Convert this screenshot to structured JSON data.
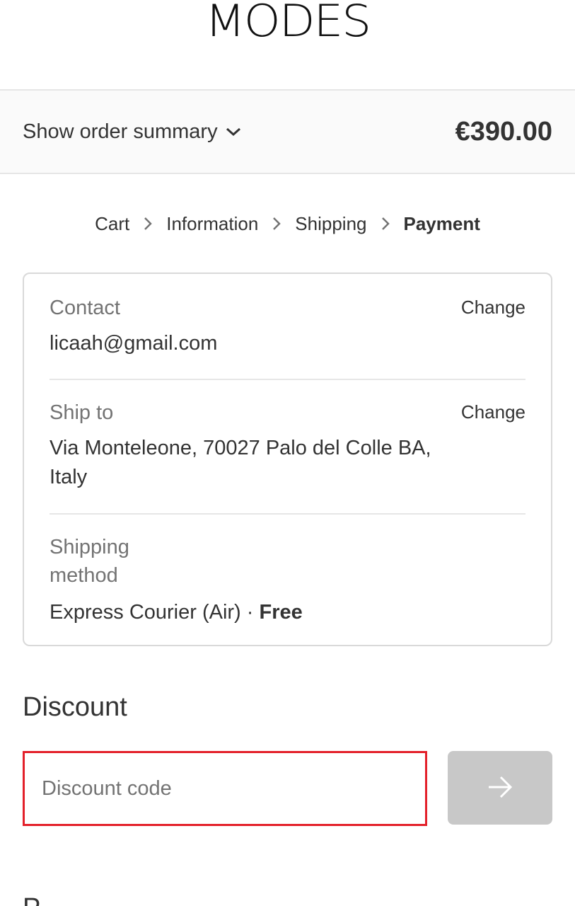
{
  "brand": {
    "logo_text": "MODES"
  },
  "summary": {
    "toggle_label": "Show order summary",
    "total": "€390.00"
  },
  "breadcrumb": {
    "items": [
      "Cart",
      "Information",
      "Shipping",
      "Payment"
    ]
  },
  "review": {
    "contact": {
      "label": "Contact",
      "value": "licaah@gmail.com",
      "action": "Change"
    },
    "ship_to": {
      "label": "Ship to",
      "value": "Via Monteleone, 70027 Palo del Colle BA, Italy",
      "action": "Change"
    },
    "shipping_method": {
      "label": "Shipping method",
      "value": "Express Courier (Air) · ",
      "price": "Free"
    }
  },
  "discount": {
    "title": "Discount",
    "placeholder": "Discount code",
    "value": ""
  },
  "next_section": {
    "title_partial": "P"
  },
  "colors": {
    "highlight_border": "#e3202a",
    "apply_button_disabled": "#c8c8c8",
    "summary_bg": "#fafafa"
  }
}
